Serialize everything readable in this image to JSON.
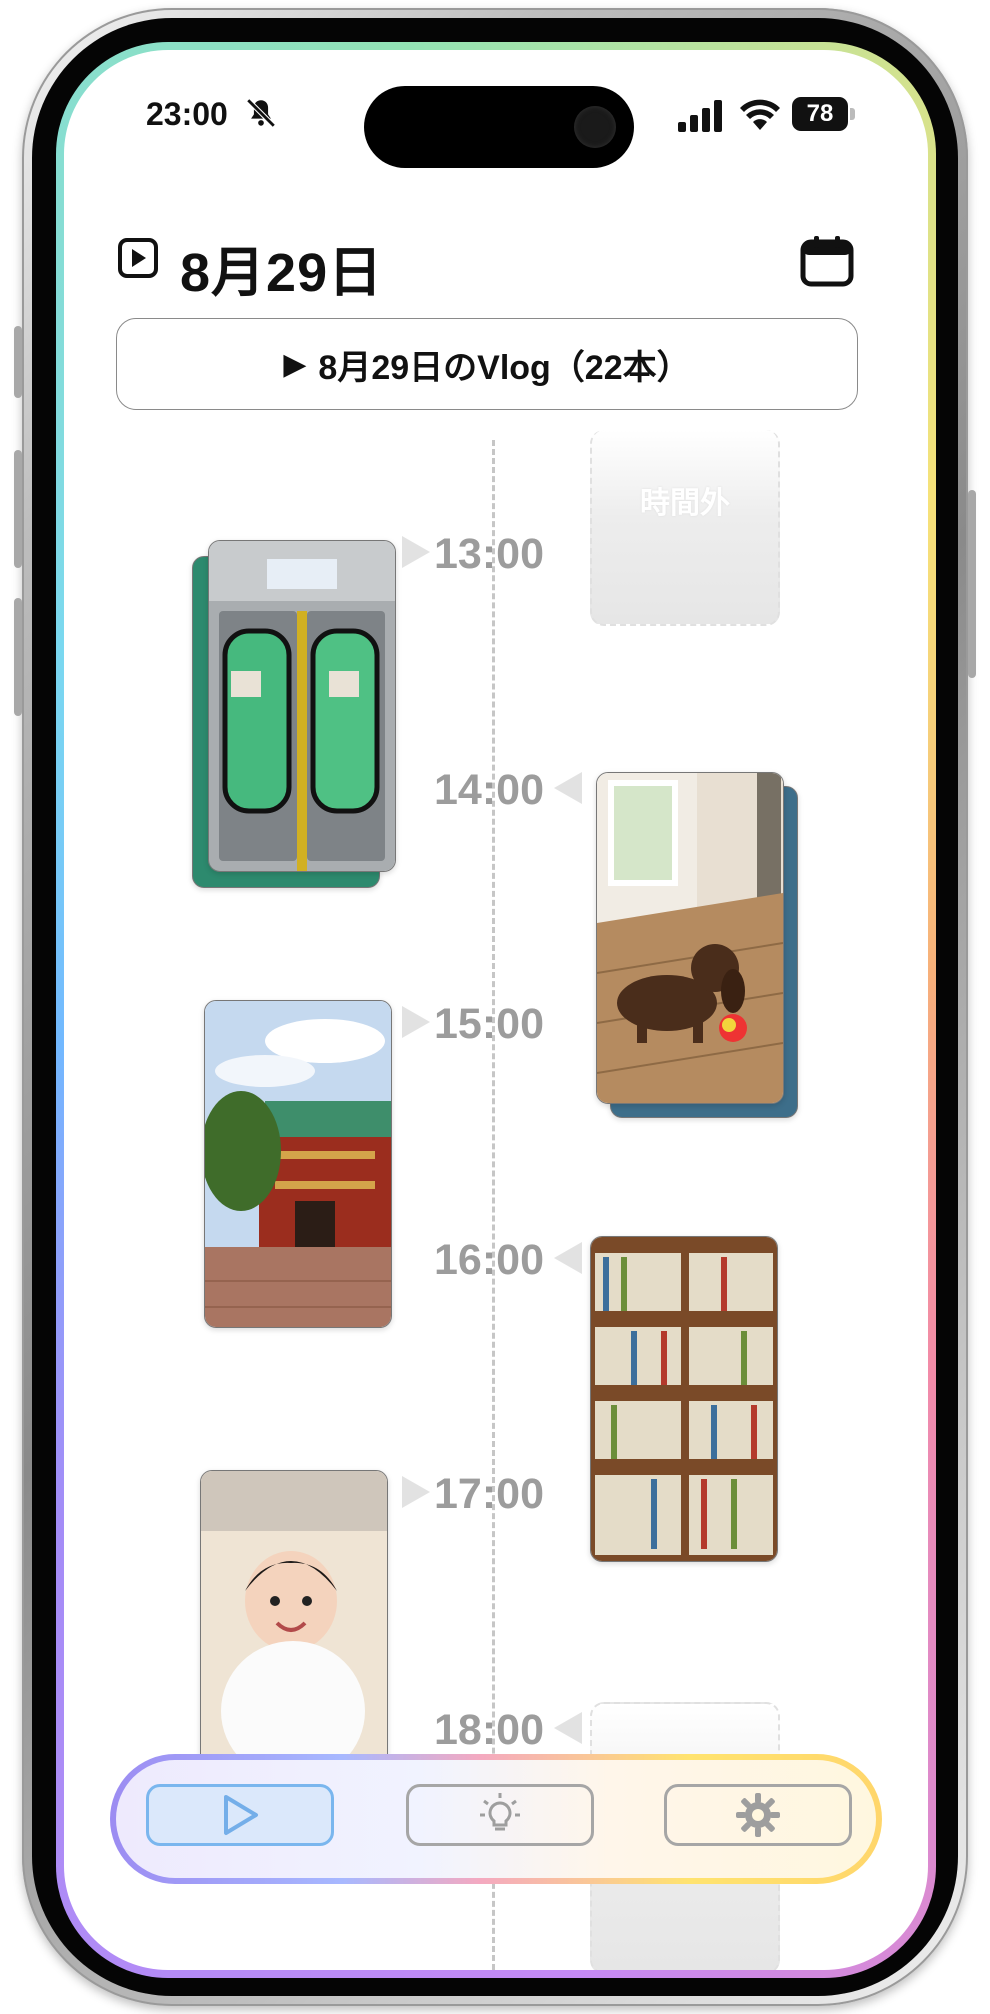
{
  "status_bar": {
    "time": "23:00",
    "battery": "78",
    "icons": [
      "bell-slash-icon",
      "signal-icon",
      "wifi-icon",
      "battery-icon"
    ]
  },
  "header": {
    "title": "8月29日",
    "play_icon": "play-square-icon",
    "calendar_icon": "calendar-icon",
    "vlog_button": {
      "arrow": "▶",
      "label": "8月29日のVlog（22本）"
    }
  },
  "timeline": {
    "hours": [
      "13:00",
      "14:00",
      "15:00",
      "16:00",
      "17:00",
      "18:00"
    ],
    "placeholder_label": "時間外",
    "clips": [
      {
        "hour": "13:00",
        "side": "left",
        "subject": "train-door-photo",
        "stacked": true
      },
      {
        "hour": "14:00",
        "side": "right",
        "subject": "dachshund-puppy-photo",
        "stacked": true
      },
      {
        "hour": "15:00",
        "side": "left",
        "subject": "shrine-gate-photo",
        "stacked": false
      },
      {
        "hour": "16:00",
        "side": "right",
        "subject": "bookshelf-photo",
        "stacked": false
      },
      {
        "hour": "17:00",
        "side": "left",
        "subject": "baby-photo",
        "stacked": false
      }
    ]
  },
  "tab_bar": {
    "tabs": [
      {
        "name": "play",
        "icon": "play-icon",
        "active": true
      },
      {
        "name": "ideas",
        "icon": "lightbulb-icon",
        "active": false
      },
      {
        "name": "settings",
        "icon": "gear-icon",
        "active": false
      }
    ],
    "colors": {
      "active_border": "#7ab6ee",
      "active_fill": "#dbe8fb",
      "inactive_border": "#a6a6a6"
    }
  },
  "colors": {
    "timeline_text": "#9c9c9c",
    "frame_gradient": [
      "#f28ba8",
      "#c58af5",
      "#72b8ff",
      "#7ad8f0",
      "#93e3b4",
      "#f6e27a",
      "#f7b07a"
    ]
  }
}
